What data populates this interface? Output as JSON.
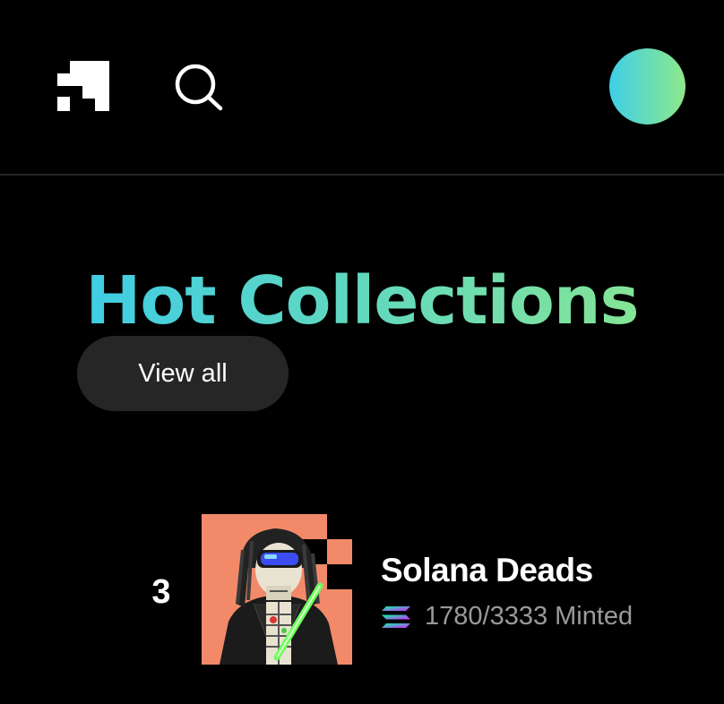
{
  "header": {
    "logo_icon": "magic-eden-logo-icon",
    "search_icon": "search-icon",
    "avatar_gradient": [
      "#3ecfe8",
      "#8ee88a"
    ]
  },
  "hero": {
    "title": "Hot Collections",
    "gradient": [
      "#35c9f0",
      "#8fe88b"
    ]
  },
  "actions": {
    "view_all_label": "View all",
    "view_all_bg": "#262626"
  },
  "collections": [
    {
      "rank": "3",
      "name": "Solana Deads",
      "chain_icon": "solana-icon",
      "minted": "1780/3333 Minted",
      "thumb_bg": "#f28a6a"
    }
  ]
}
